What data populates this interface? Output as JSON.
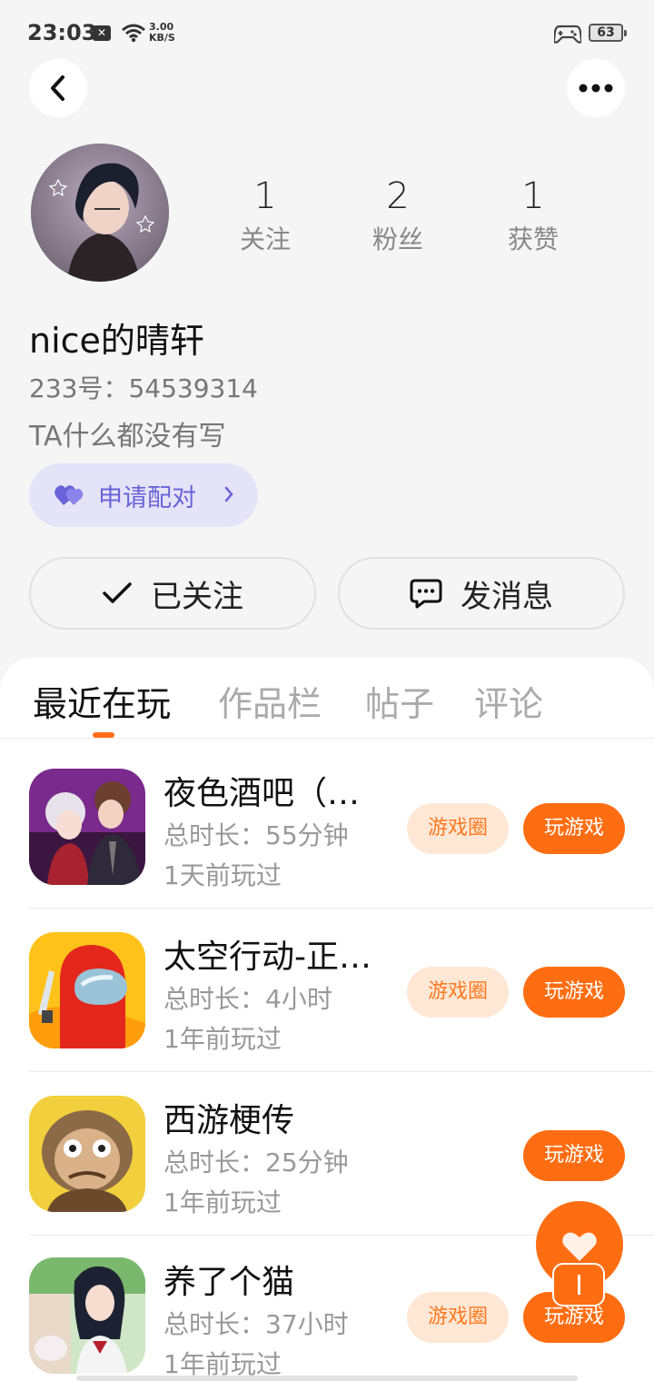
{
  "status_bar": {
    "time": "23:03",
    "notif_icon": "x-notification-icon",
    "speed_value": "3.00",
    "speed_unit": "KB/S",
    "battery": "63"
  },
  "header": {
    "back_icon": "chevron-left-icon",
    "more_icon": "more-horizontal-icon"
  },
  "profile": {
    "stats": [
      {
        "count": "1",
        "label": "关注"
      },
      {
        "count": "2",
        "label": "粉丝"
      },
      {
        "count": "1",
        "label": "获赞"
      }
    ],
    "username": "nice的晴轩",
    "uid_label": "233号：",
    "uid": "54539314",
    "bio": "TA什么都没有写",
    "pair_button": "申请配对",
    "follow_button": "已关注",
    "message_button": "发消息"
  },
  "tabs": [
    "最近在玩",
    "作品栏",
    "帖子",
    "评论"
  ],
  "games": [
    {
      "name": "夜色酒吧（…",
      "time": "总时长：55分钟",
      "last_played": "1天前玩过",
      "circle": "游戏圈",
      "play": "玩游戏"
    },
    {
      "name": "太空行动-正…",
      "time": "总时长：4小时",
      "last_played": "1年前玩过",
      "circle": "游戏圈",
      "play": "玩游戏"
    },
    {
      "name": "西游梗传",
      "time": "总时长：25分钟",
      "last_played": "1年前玩过",
      "circle": "",
      "play": "玩游戏"
    },
    {
      "name": "养了个猫",
      "time": "总时长：37小时",
      "last_played": "1年前玩过",
      "circle": "游戏圈",
      "play": "玩游戏"
    }
  ],
  "colors": {
    "accent": "#ff6d12",
    "pair_bg": "#e5e3f8",
    "pair_text": "#6a63d8",
    "circle_bg": "#ffe7d6"
  }
}
